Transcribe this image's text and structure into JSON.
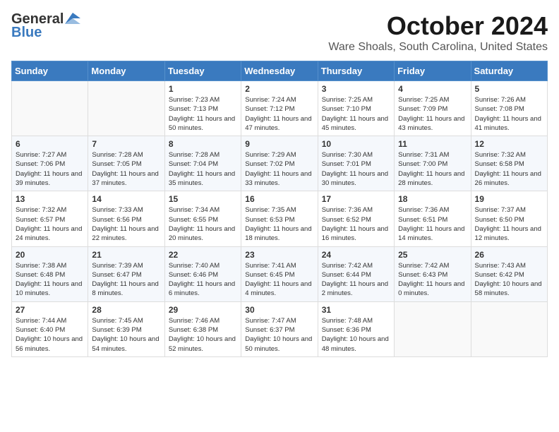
{
  "header": {
    "logo_general": "General",
    "logo_blue": "Blue",
    "month_title": "October 2024",
    "location": "Ware Shoals, South Carolina, United States"
  },
  "weekdays": [
    "Sunday",
    "Monday",
    "Tuesday",
    "Wednesday",
    "Thursday",
    "Friday",
    "Saturday"
  ],
  "weeks": [
    [
      {
        "day": "",
        "info": ""
      },
      {
        "day": "",
        "info": ""
      },
      {
        "day": "1",
        "info": "Sunrise: 7:23 AM\nSunset: 7:13 PM\nDaylight: 11 hours and 50 minutes."
      },
      {
        "day": "2",
        "info": "Sunrise: 7:24 AM\nSunset: 7:12 PM\nDaylight: 11 hours and 47 minutes."
      },
      {
        "day": "3",
        "info": "Sunrise: 7:25 AM\nSunset: 7:10 PM\nDaylight: 11 hours and 45 minutes."
      },
      {
        "day": "4",
        "info": "Sunrise: 7:25 AM\nSunset: 7:09 PM\nDaylight: 11 hours and 43 minutes."
      },
      {
        "day": "5",
        "info": "Sunrise: 7:26 AM\nSunset: 7:08 PM\nDaylight: 11 hours and 41 minutes."
      }
    ],
    [
      {
        "day": "6",
        "info": "Sunrise: 7:27 AM\nSunset: 7:06 PM\nDaylight: 11 hours and 39 minutes."
      },
      {
        "day": "7",
        "info": "Sunrise: 7:28 AM\nSunset: 7:05 PM\nDaylight: 11 hours and 37 minutes."
      },
      {
        "day": "8",
        "info": "Sunrise: 7:28 AM\nSunset: 7:04 PM\nDaylight: 11 hours and 35 minutes."
      },
      {
        "day": "9",
        "info": "Sunrise: 7:29 AM\nSunset: 7:02 PM\nDaylight: 11 hours and 33 minutes."
      },
      {
        "day": "10",
        "info": "Sunrise: 7:30 AM\nSunset: 7:01 PM\nDaylight: 11 hours and 30 minutes."
      },
      {
        "day": "11",
        "info": "Sunrise: 7:31 AM\nSunset: 7:00 PM\nDaylight: 11 hours and 28 minutes."
      },
      {
        "day": "12",
        "info": "Sunrise: 7:32 AM\nSunset: 6:58 PM\nDaylight: 11 hours and 26 minutes."
      }
    ],
    [
      {
        "day": "13",
        "info": "Sunrise: 7:32 AM\nSunset: 6:57 PM\nDaylight: 11 hours and 24 minutes."
      },
      {
        "day": "14",
        "info": "Sunrise: 7:33 AM\nSunset: 6:56 PM\nDaylight: 11 hours and 22 minutes."
      },
      {
        "day": "15",
        "info": "Sunrise: 7:34 AM\nSunset: 6:55 PM\nDaylight: 11 hours and 20 minutes."
      },
      {
        "day": "16",
        "info": "Sunrise: 7:35 AM\nSunset: 6:53 PM\nDaylight: 11 hours and 18 minutes."
      },
      {
        "day": "17",
        "info": "Sunrise: 7:36 AM\nSunset: 6:52 PM\nDaylight: 11 hours and 16 minutes."
      },
      {
        "day": "18",
        "info": "Sunrise: 7:36 AM\nSunset: 6:51 PM\nDaylight: 11 hours and 14 minutes."
      },
      {
        "day": "19",
        "info": "Sunrise: 7:37 AM\nSunset: 6:50 PM\nDaylight: 11 hours and 12 minutes."
      }
    ],
    [
      {
        "day": "20",
        "info": "Sunrise: 7:38 AM\nSunset: 6:48 PM\nDaylight: 11 hours and 10 minutes."
      },
      {
        "day": "21",
        "info": "Sunrise: 7:39 AM\nSunset: 6:47 PM\nDaylight: 11 hours and 8 minutes."
      },
      {
        "day": "22",
        "info": "Sunrise: 7:40 AM\nSunset: 6:46 PM\nDaylight: 11 hours and 6 minutes."
      },
      {
        "day": "23",
        "info": "Sunrise: 7:41 AM\nSunset: 6:45 PM\nDaylight: 11 hours and 4 minutes."
      },
      {
        "day": "24",
        "info": "Sunrise: 7:42 AM\nSunset: 6:44 PM\nDaylight: 11 hours and 2 minutes."
      },
      {
        "day": "25",
        "info": "Sunrise: 7:42 AM\nSunset: 6:43 PM\nDaylight: 11 hours and 0 minutes."
      },
      {
        "day": "26",
        "info": "Sunrise: 7:43 AM\nSunset: 6:42 PM\nDaylight: 10 hours and 58 minutes."
      }
    ],
    [
      {
        "day": "27",
        "info": "Sunrise: 7:44 AM\nSunset: 6:40 PM\nDaylight: 10 hours and 56 minutes."
      },
      {
        "day": "28",
        "info": "Sunrise: 7:45 AM\nSunset: 6:39 PM\nDaylight: 10 hours and 54 minutes."
      },
      {
        "day": "29",
        "info": "Sunrise: 7:46 AM\nSunset: 6:38 PM\nDaylight: 10 hours and 52 minutes."
      },
      {
        "day": "30",
        "info": "Sunrise: 7:47 AM\nSunset: 6:37 PM\nDaylight: 10 hours and 50 minutes."
      },
      {
        "day": "31",
        "info": "Sunrise: 7:48 AM\nSunset: 6:36 PM\nDaylight: 10 hours and 48 minutes."
      },
      {
        "day": "",
        "info": ""
      },
      {
        "day": "",
        "info": ""
      }
    ]
  ]
}
